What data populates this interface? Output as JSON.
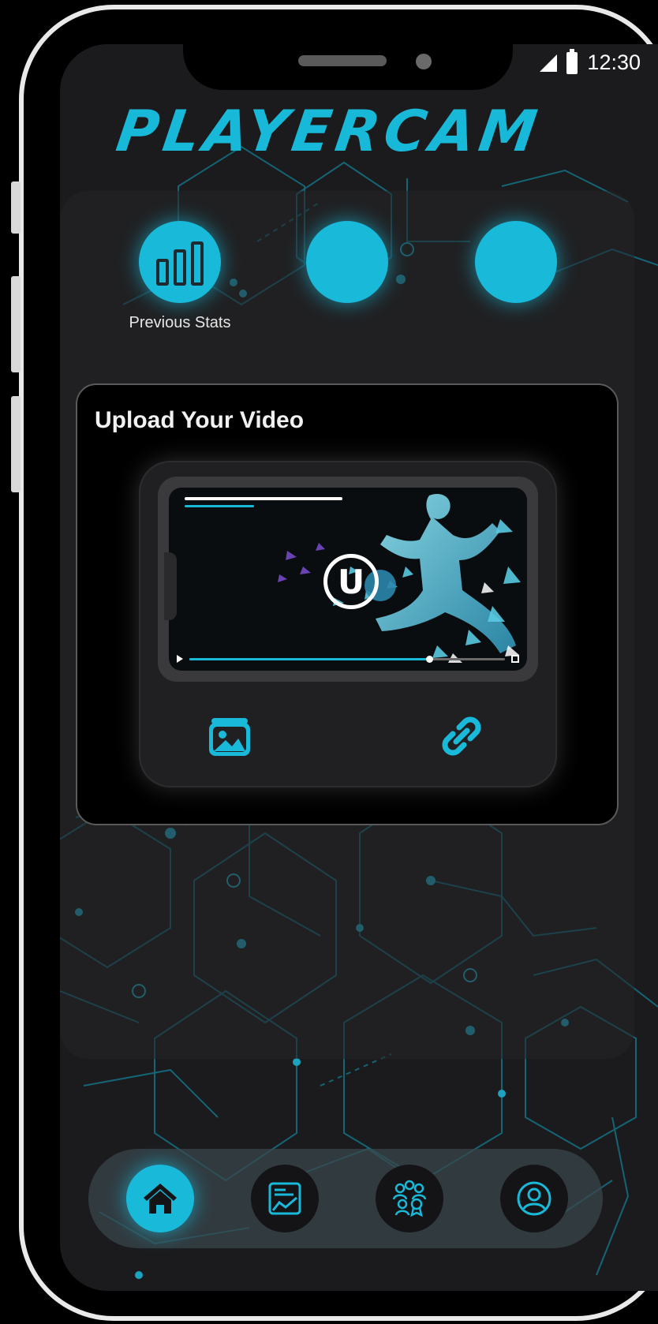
{
  "status_bar": {
    "time": "12:30",
    "icons": [
      "signal-icon",
      "battery-icon"
    ]
  },
  "app": {
    "brand": "PLAYERCAM",
    "accent_color": "#18b9d8",
    "background_color": "#1b1b1d"
  },
  "quick_actions": [
    {
      "label": "Previous Stats",
      "icon": "bar-chart-icon"
    },
    {
      "label": "",
      "icon": ""
    },
    {
      "label": "",
      "icon": ""
    }
  ],
  "upload": {
    "title": "Upload Your Video",
    "preview": {
      "progress": 0.76
    },
    "buttons": [
      {
        "icon": "gallery-icon"
      },
      {
        "icon": "link-icon"
      }
    ]
  },
  "bottom_nav": [
    {
      "icon": "home-icon",
      "active": true
    },
    {
      "icon": "analytics-icon",
      "active": false
    },
    {
      "icon": "team-award-icon",
      "active": false
    },
    {
      "icon": "profile-icon",
      "active": false
    }
  ]
}
